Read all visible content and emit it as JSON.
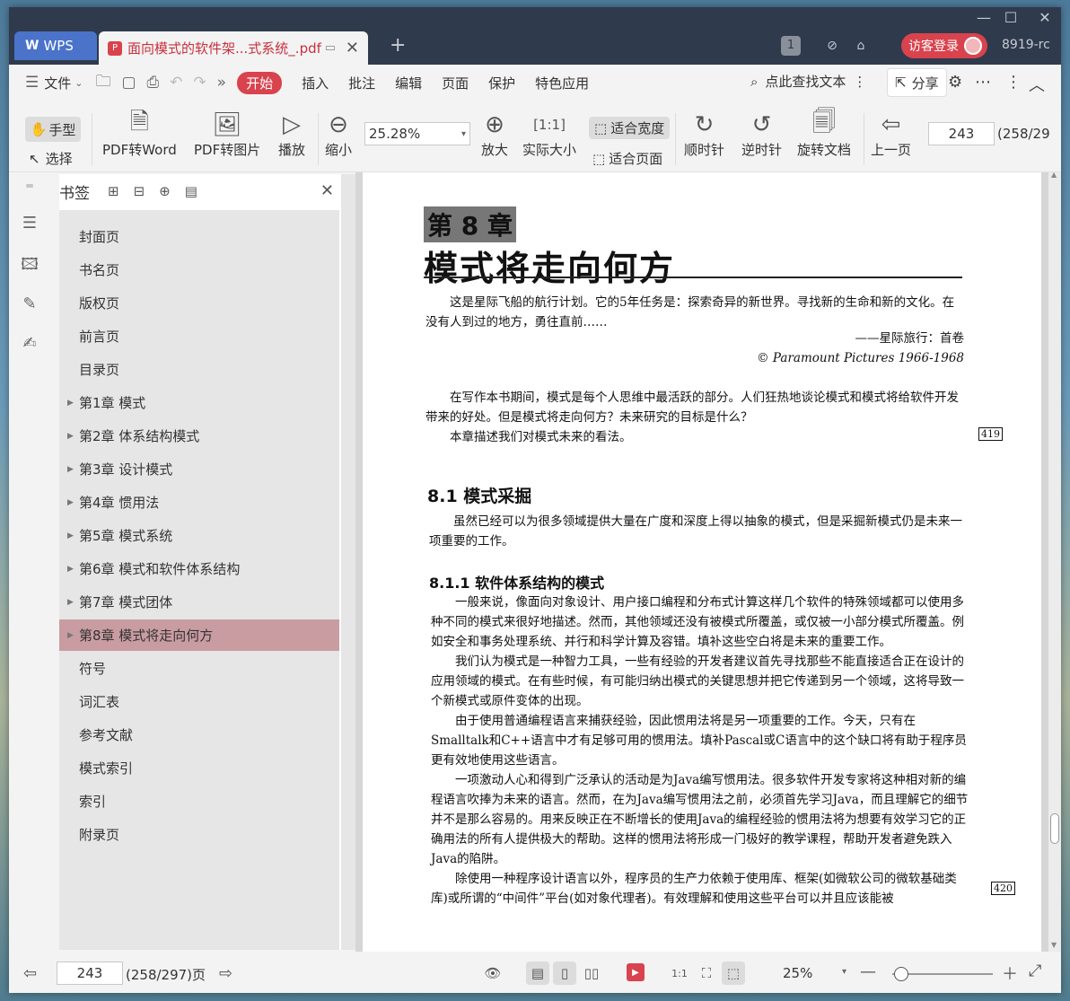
{
  "window": {
    "controls": [
      "—",
      "☐",
      "✕"
    ]
  },
  "tabs": {
    "wps_label": "WPS",
    "doc_title": "面向模式的软件架...式系统_.pdf",
    "add": "+"
  },
  "topright": {
    "badge": "1",
    "login_label": "访客登录",
    "user": "8919-rc"
  },
  "menu": {
    "file": "文件",
    "items": [
      "开始",
      "插入",
      "批注",
      "编辑",
      "页面",
      "保护",
      "特色应用"
    ],
    "search_label": "点此查找文本",
    "share_label": "分享"
  },
  "toolbar": {
    "hand": "手型",
    "select": "选择",
    "pdf_to_word": "PDF转Word",
    "pdf_to_image": "PDF转图片",
    "play": "播放",
    "zoom_out": "缩小",
    "zoom_value": "25.28%",
    "zoom_in": "放大",
    "actual_size": "实际大小",
    "fit_width": "适合宽度",
    "fit_page": "适合页面",
    "clockwise": "顺时针",
    "counterclockwise": "逆时针",
    "rotate_doc": "旋转文档",
    "prev_page": "上一页",
    "page_value": "243",
    "page_total": "(258/29"
  },
  "bookmarks": {
    "title": "书签",
    "items": [
      {
        "label": "封面页",
        "expandable": false
      },
      {
        "label": "书名页",
        "expandable": false
      },
      {
        "label": "版权页",
        "expandable": false
      },
      {
        "label": "前言页",
        "expandable": false
      },
      {
        "label": "目录页",
        "expandable": false
      },
      {
        "label": "第1章  模式",
        "expandable": true
      },
      {
        "label": "第2章  体系结构模式",
        "expandable": true
      },
      {
        "label": "第3章  设计模式",
        "expandable": true
      },
      {
        "label": "第4章  惯用法",
        "expandable": true
      },
      {
        "label": "第5章  模式系统",
        "expandable": true
      },
      {
        "label": "第6章  模式和软件体系结构",
        "expandable": true
      },
      {
        "label": "第7章  模式团体",
        "expandable": true
      },
      {
        "label": "第8章  模式将走向何方",
        "expandable": true,
        "active": true
      },
      {
        "label": "符号",
        "expandable": false
      },
      {
        "label": "词汇表",
        "expandable": false
      },
      {
        "label": "参考文献",
        "expandable": false
      },
      {
        "label": "模式索引",
        "expandable": false
      },
      {
        "label": "索引",
        "expandable": false
      },
      {
        "label": "附录页",
        "expandable": false
      }
    ]
  },
  "document": {
    "chapter_number": "第 8 章",
    "chapter_title": "模式将走向何方",
    "epigraph": "这是星际飞船的航行计划。它的5年任务是：探索奇异的新世界。寻找新的生命和新的文化。在没有人到过的地方，勇往直前……",
    "epigraph_attr": "——星际旅行：首卷",
    "epigraph_copy": "© Paramount Pictures 1966-1968",
    "intro_p1": "在写作本书期间，模式是每个人思维中最活跃的部分。人们狂热地谈论模式和模式将给软件开发带来的好处。但是模式将走向何方？未来研究的目标是什么？",
    "intro_p2": "本章描述我们对模式未来的看法。",
    "page_no_1": "419",
    "section_title": "8.1   模式采掘",
    "section_p": "虽然已经可以为很多领域提供大量在广度和深度上得以抽象的模式，但是采掘新模式仍是未来一项重要的工作。",
    "subsection_title": "8.1.1   软件体系结构的模式",
    "body_p1": "一般来说，像面向对象设计、用户接口编程和分布式计算这样几个软件的特殊领域都可以使用多种不同的模式来很好地描述。然而，其他领域还没有被模式所覆盖，或仅被一小部分模式所覆盖。例如安全和事务处理系统、并行和科学计算及容错。填补这些空白将是未来的重要工作。",
    "body_p2": "我们认为模式是一种智力工具，一些有经验的开发者建议首先寻找那些不能直接适合正在设计的应用领域的模式。在有些时候，有可能归纳出模式的关键思想并把它传递到另一个领域，这将导致一个新模式或原件变体的出现。",
    "body_p3": "由于使用普通编程语言来捕获经验，因此惯用法将是另一项重要的工作。今天，只有在Smalltalk和C++语言中才有足够可用的惯用法。填补Pascal或C语言中的这个缺口将有助于程序员更有效地使用这些语言。",
    "body_p4": "一项激动人心和得到广泛承认的活动是为Java编写惯用法。很多软件开发专家将这种相对新的编程语言吹捧为未来的语言。然而，在为Java编写惯用法之前，必须首先学习Java，而且理解它的细节并不是那么容易的。用来反映正在不断增长的使用Java的编程经验的惯用法将为想要有效学习它的正确用法的所有人提供极大的帮助。这样的惯用法将形成一门极好的教学课程，帮助开发者避免跌入Java的陷阱。",
    "body_p5": "除使用一种程序设计语言以外，程序员的生产力依赖于使用库、框架(如微软公司的微软基础类库)或所谓的“中间件”平台(如对象代理者)。有效理解和使用这些平台可以并且应该能被",
    "page_no_2": "420"
  },
  "status": {
    "page_value": "243",
    "page_total": "(258/297)页",
    "zoom": "25%",
    "zoom_fraction": 0.02
  },
  "colors": {
    "accent": "#d9434e",
    "titlebar": "#2f3a4c",
    "bookmark_active": "#c99ca2"
  }
}
